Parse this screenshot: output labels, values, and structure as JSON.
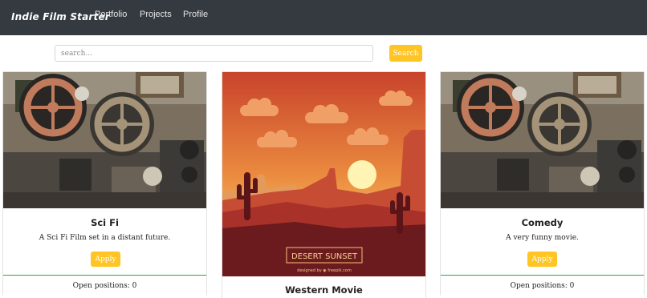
{
  "navbar": {
    "brand": "Indie Film Starter",
    "links": [
      "Portfolio",
      "Projects",
      "Profile"
    ]
  },
  "search": {
    "placeholder": "search...",
    "button_label": "Search"
  },
  "cards": [
    {
      "title": "Sci Fi",
      "description": "A Sci Fi Film set in a distant future.",
      "apply_label": "Apply",
      "open_positions": "Open positions: 0"
    },
    {
      "title": "Western Movie",
      "image_caption": "DESERT SUNSET",
      "image_credit": "designed by ◉ freepik.com"
    },
    {
      "title": "Comedy",
      "description": "A very funny movie.",
      "apply_label": "Apply",
      "open_positions": "Open positions: 0"
    }
  ],
  "colors": {
    "navbar_bg": "#343a40",
    "accent_yellow": "#ffc524",
    "footer_border_green": "#28a745"
  }
}
